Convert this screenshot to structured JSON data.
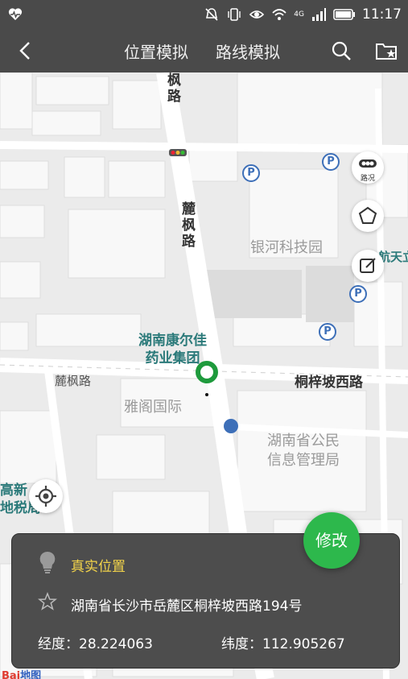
{
  "status_bar": {
    "network": "4G",
    "time": "11:17"
  },
  "header": {
    "tabs": [
      {
        "label": "位置模拟"
      },
      {
        "label": "路线模拟"
      }
    ]
  },
  "map": {
    "roads": {
      "lufeng_top": "枫\n路",
      "lufeng_vertical": "麓枫路",
      "lufeng_left": "麓枫路",
      "tongzipo": "桐梓坡西路"
    },
    "pois": {
      "kangerjia": "湖南康尔佳\n药业集团",
      "yinhe": "银河科技园",
      "yage": "雅阁国际",
      "gongmin": "湖南省公民\n信息管理局",
      "gaoxin": "高新\n地税局",
      "hangtian": "航天立"
    },
    "traffic_button_label": "路况",
    "parking_label": "P",
    "watermark": {
      "part1": "Bai",
      "part2": "地图"
    }
  },
  "modify_button": {
    "label": "修改"
  },
  "info_panel": {
    "title": "真实位置",
    "address": "湖南省长沙市岳麓区桐梓坡西路194号",
    "longitude_label": "经度：",
    "longitude": "28.224063",
    "latitude_label": "纬度：",
    "latitude": "112.905267"
  },
  "colors": {
    "bar_bg": "#4a4a4a",
    "accent_green": "#2db84c",
    "title_yellow": "#f1d24a"
  }
}
